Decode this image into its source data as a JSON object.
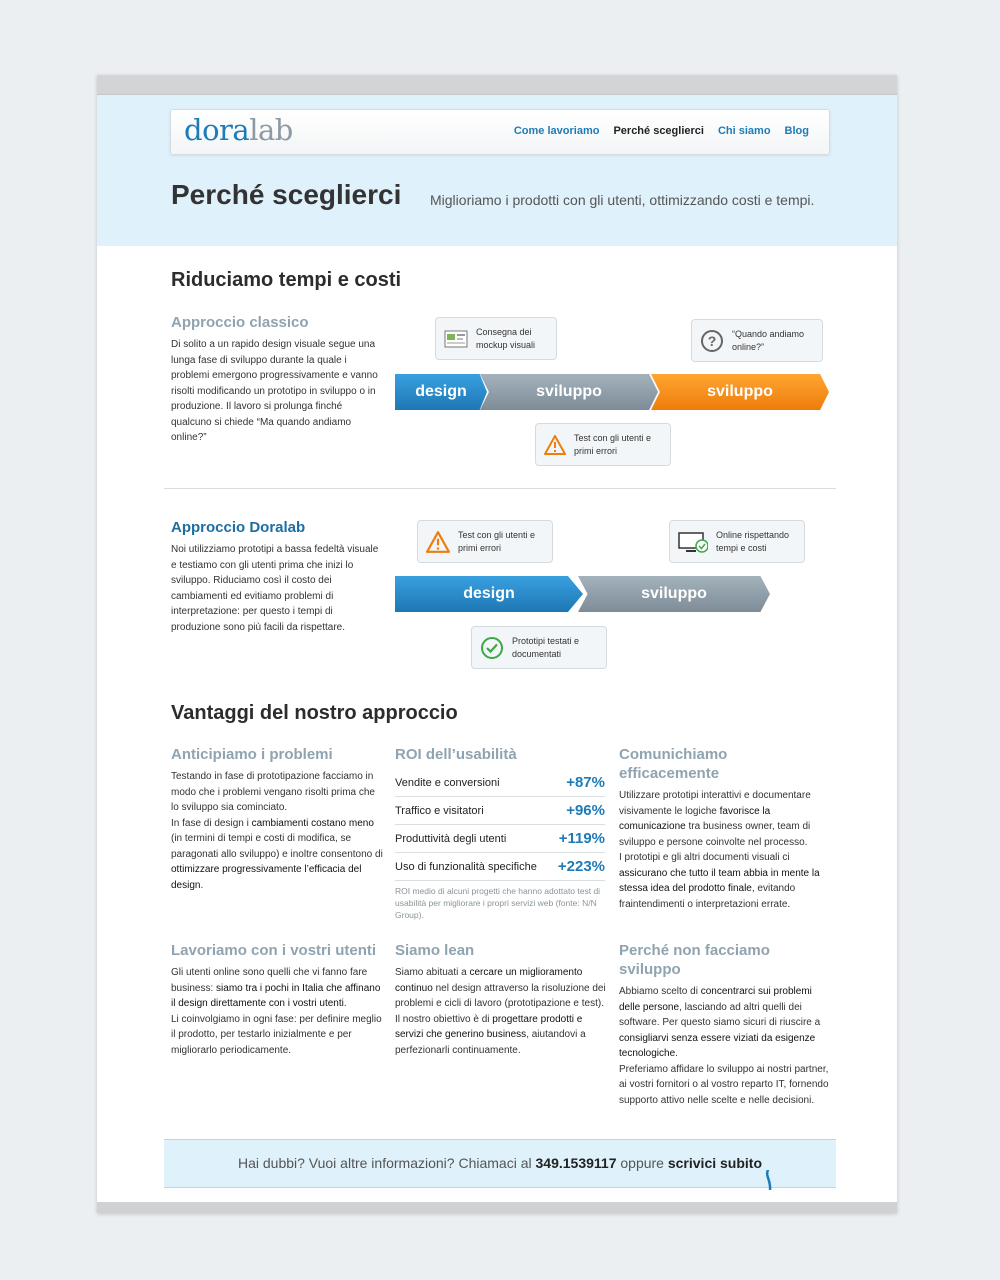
{
  "brand": {
    "logo_part1": "dora",
    "logo_part2": "lab"
  },
  "nav": [
    {
      "label": "Come lavoriamo",
      "active": false
    },
    {
      "label": "Perché sceglierci",
      "active": true
    },
    {
      "label": "Chi siamo",
      "active": false
    },
    {
      "label": "Blog",
      "active": false
    }
  ],
  "hero": {
    "title": "Perché sceglierci",
    "tagline": "Miglioriamo i prodotti con gli utenti, ottimizzando costi e tempi."
  },
  "section1": {
    "title": "Riduciamo tempi e costi",
    "classic": {
      "title": "Approccio classico",
      "text": "Di solito a un rapido design visuale segue una lunga fase di sviluppo durante la quale i problemi emergono progressivamente e vanno risolti modificando un prototipo in sviluppo o in produzione. Il lavoro si prolunga finché qualcuno si chiede “Ma quando andiamo online?”",
      "steps": [
        "design",
        "sviluppo",
        "sviluppo"
      ],
      "callout_mockup": "Consegna dei mockup visuali",
      "callout_online": "“Quando andiamo online?”",
      "callout_test": "Test con gli utenti e primi errori"
    },
    "doralab": {
      "title": "Approccio Doralab",
      "text": "Noi utilizziamo prototipi a bassa fedeltà visuale e testiamo con gli utenti prima che inizi lo sviluppo. Riduciamo così il costo dei cambiamenti ed evitiamo problemi di interpretazione: per questo i tempi di produzione sono più facili da rispettare.",
      "steps": [
        "design",
        "sviluppo"
      ],
      "callout_test": "Test con gli utenti e primi errori",
      "callout_online": "Online rispettando tempi e costi",
      "callout_proto": "Prototipi testati e documentati"
    }
  },
  "section2": {
    "title": "Vantaggi del nostro approccio",
    "col1": {
      "title": "Anticipiamo i problemi",
      "p1": "Testando in fase di prototipazione facciamo in modo che i problemi vengano risolti prima che lo sviluppo sia cominciato.",
      "p2a": "In fase di design i ",
      "p2b": "cambiamenti costano meno",
      "p2c": " (in termini di tempi e costi di modifica, se paragonati allo sviluppo) e inoltre consentono di ",
      "p2d": "ottimizzare progressivamente l’efficacia del design",
      "p2e": "."
    },
    "roi": {
      "title": "ROI dell’usabilità",
      "rows": [
        {
          "label": "Vendite e conversioni",
          "value": "+87%"
        },
        {
          "label": "Traffico e visitatori",
          "value": "+96%"
        },
        {
          "label": "Produttività degli utenti",
          "value": "+119%"
        },
        {
          "label": "Uso di funzionalità specifiche",
          "value": "+223%"
        }
      ],
      "note": "ROI medio di alcuni progetti che hanno adottato test di usabilità per migliorare i propri servizi web (fonte: N/N Group)."
    },
    "col3": {
      "title": "Comunichiamo efficacemente",
      "p1a": "Utilizzare prototipi interattivi e documentare visivamente le logiche ",
      "p1b": "favorisce la comunicazione",
      "p1c": " tra business owner, team di sviluppo e persone coinvolte nel processo.",
      "p2a": "I prototipi e gli altri documenti visuali ci ",
      "p2b": "assicurano che tutto il team abbia in mente la stessa idea del prodotto finale",
      "p2c": ", evitando fraintendimenti o interpretazioni errate."
    },
    "col4": {
      "title": "Lavoriamo con i vostri utenti",
      "p1a": "Gli utenti online sono quelli che vi fanno fare business: ",
      "p1b": "siamo tra i pochi in Italia che affinano il design direttamente con i vostri utenti",
      "p1c": ".",
      "p2": "Li coinvolgiamo in ogni fase: per definire meglio il prodotto, per testarlo inizialmente e per migliorarlo periodicamente."
    },
    "col5": {
      "title": "Siamo lean",
      "p1a": "Siamo abituati a ",
      "p1b": "cercare un miglioramento continuo",
      "p1c": " nel design attraverso la risoluzione dei problemi e cicli di lavoro (prototipazione e test).",
      "p2a": "Il nostro obiettivo è di ",
      "p2b": "progettare prodotti e servizi che generino business",
      "p2c": ", aiutandovi a perfezionarli continuamente."
    },
    "col6": {
      "title": "Perché non facciamo sviluppo",
      "p1a": "Abbiamo scelto di ",
      "p1b": "concentrarci sui problemi delle persone",
      "p1c": ", lasciando ad altri quelli dei software. Per questo siamo sicuri di riuscire a ",
      "p1d": "consigliarvi senza essere viziati da esigenze tecnologiche",
      "p1e": ".",
      "p2": "Preferiamo affidare lo sviluppo ai nostri partner, ai vostri fornitori o al vostro reparto IT, fornendo supporto attivo nelle scelte e nelle decisioni."
    }
  },
  "footer": {
    "text1": "Hai dubbi? Vuoi altre informazioni? Chiamaci al ",
    "phone": "349.1539117",
    "text2": " oppure ",
    "cta": "scrivici subito"
  },
  "colors": {
    "accent": "#1d7bb8",
    "orange": "#ee7d0c",
    "hero_bg": "#dff1fb"
  }
}
